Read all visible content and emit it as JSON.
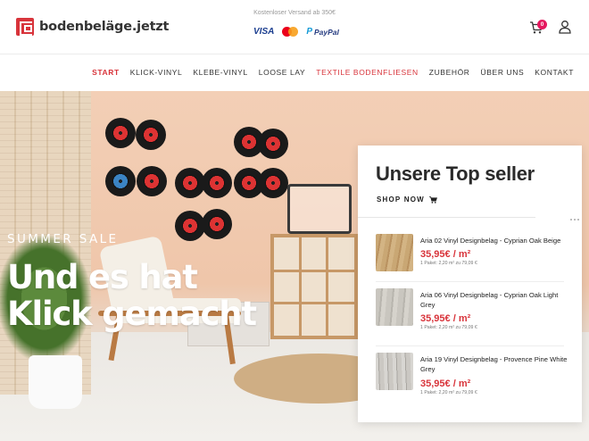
{
  "brand": {
    "name": "bodenbeläge.jetzt"
  },
  "header": {
    "shipping_note": "Kostenloser Versand ab 350€",
    "payments": [
      "VISA",
      "Mastercard",
      "PayPal"
    ],
    "cart_count": "0",
    "icons": {
      "cart": "cart-icon",
      "user": "user-icon"
    }
  },
  "nav": {
    "items": [
      "START",
      "KLICK-VINYL",
      "KLEBE-VINYL",
      "LOOSE LAY",
      "TEXTILE BODENFLIESEN",
      "ZUBEHÖR",
      "ÜBER UNS",
      "KONTAKT"
    ],
    "active_index": 0,
    "accent_index": 4
  },
  "hero": {
    "tagline": "SUMMER SALE",
    "headline": "Und es hat Klick gemacht"
  },
  "topseller": {
    "title_prefix": "Unsere ",
    "title_bold": "Top",
    "title_suffix": " seller",
    "cta": "SHOP NOW",
    "products": [
      {
        "name": "Aria 02 Vinyl Designbelag - Cyprian Oak Beige",
        "price": "35,95€ / m²",
        "unit_note": "1 Paket: 2,20 m² zu 79,09 €"
      },
      {
        "name": "Aria 06 Vinyl Designbelag - Cyprian Oak Light Grey",
        "price": "35,95€ / m²",
        "unit_note": "1 Paket: 2,20 m² zu 79,09 €"
      },
      {
        "name": "Aria 19 Vinyl Designbelag - Provence Pine White Grey",
        "price": "35,95€ / m²",
        "unit_note": "1 Paket: 2,20 m² zu 79,09 €"
      }
    ]
  },
  "colors": {
    "accent": "#d8343b",
    "badge": "#e5195f"
  }
}
